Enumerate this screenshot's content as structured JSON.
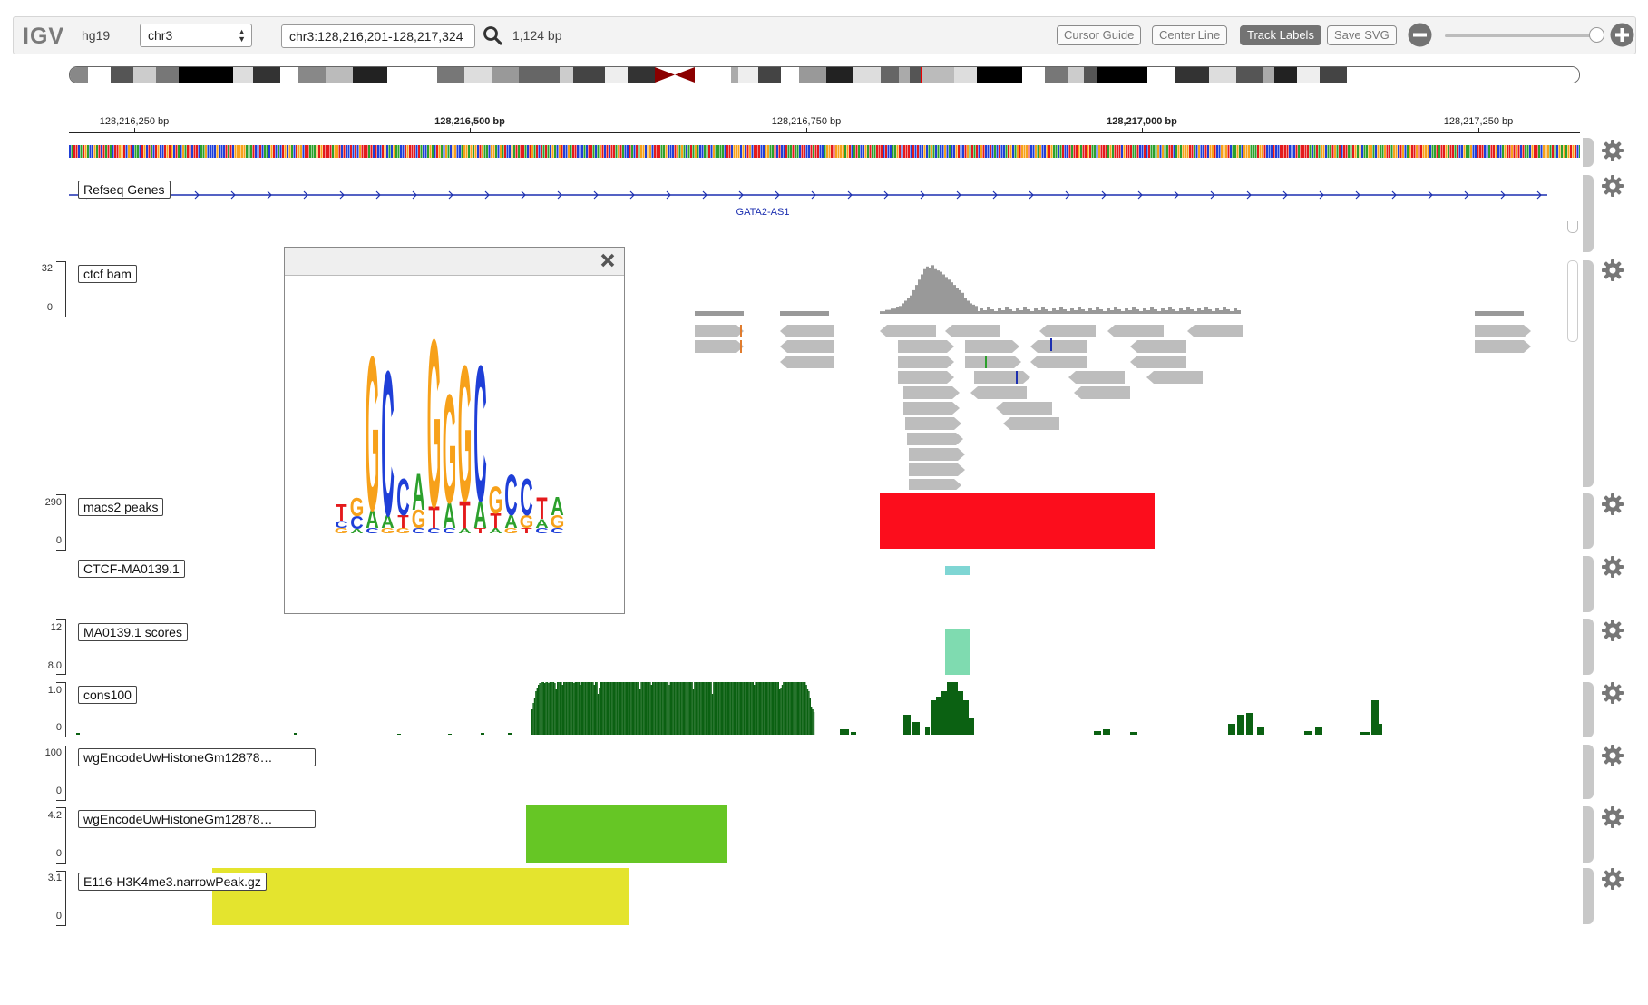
{
  "navbar": {
    "logo": "IGV",
    "genome": "hg19",
    "chromosome": "chr3",
    "locus": "chr3:128,216,201-128,217,324",
    "bp_width": "1,124 bp",
    "buttons": {
      "cursor_guide": "Cursor Guide",
      "center_line": "Center Line",
      "track_labels": "Track Labels",
      "save_svg": "Save SVG"
    }
  },
  "ruler": {
    "ticks": [
      {
        "label": "128,216,250 bp",
        "major": false
      },
      {
        "label": "128,216,500 bp",
        "major": true
      },
      {
        "label": "128,216,750 bp",
        "major": false
      },
      {
        "label": "128,217,000 bp",
        "major": true
      },
      {
        "label": "128,217,250 bp",
        "major": false
      }
    ]
  },
  "tracks": {
    "refseq": {
      "label": "Refseq Genes",
      "gene": "GATA2-AS1"
    },
    "ctcf_bam": {
      "label": "ctcf bam",
      "max": "32",
      "min": "0"
    },
    "macs2": {
      "label": "macs2 peaks",
      "max": "290",
      "min": "0",
      "color": "#fc0d1c"
    },
    "ctcf_motif": {
      "label": "CTCF-MA0139.1",
      "color": "#7fd6d4"
    },
    "ma_scores": {
      "label": "MA0139.1 scores",
      "max": "12",
      "min": "8.0",
      "color": "#7fdbb0"
    },
    "cons100": {
      "label": "cons100",
      "max": "1.0",
      "min": "0",
      "color": "#0b6112"
    },
    "histone1": {
      "label": "wgEncodeUwHistoneGm12878…",
      "max": "100",
      "min": "0"
    },
    "histone2": {
      "label": "wgEncodeUwHistoneGm12878…",
      "max": "4.2",
      "min": "0",
      "color": "#66c625"
    },
    "e116": {
      "label": "E116-H3K4me3.narrowPeak.gz",
      "max": "3.1",
      "min": "0",
      "color": "#e4e42e"
    }
  },
  "popup": {
    "logo_letters": [
      [
        "T",
        "C",
        "G"
      ],
      [
        "G",
        "C",
        "A"
      ],
      [
        "G",
        "A",
        "C"
      ],
      [
        "C",
        "A",
        "G"
      ],
      [
        "C",
        "T",
        "G"
      ],
      [
        "A",
        "G",
        "C"
      ],
      [
        "G",
        "T",
        "C"
      ],
      [
        "G",
        "A",
        "C"
      ],
      [
        "G",
        "T",
        "A"
      ],
      [
        "C",
        "A",
        "T"
      ],
      [
        "G",
        "T",
        "A"
      ],
      [
        "C",
        "A",
        "G"
      ],
      [
        "C",
        "G",
        "T"
      ],
      [
        "T",
        "A",
        "C"
      ],
      [
        "A",
        "G",
        "C"
      ]
    ]
  }
}
